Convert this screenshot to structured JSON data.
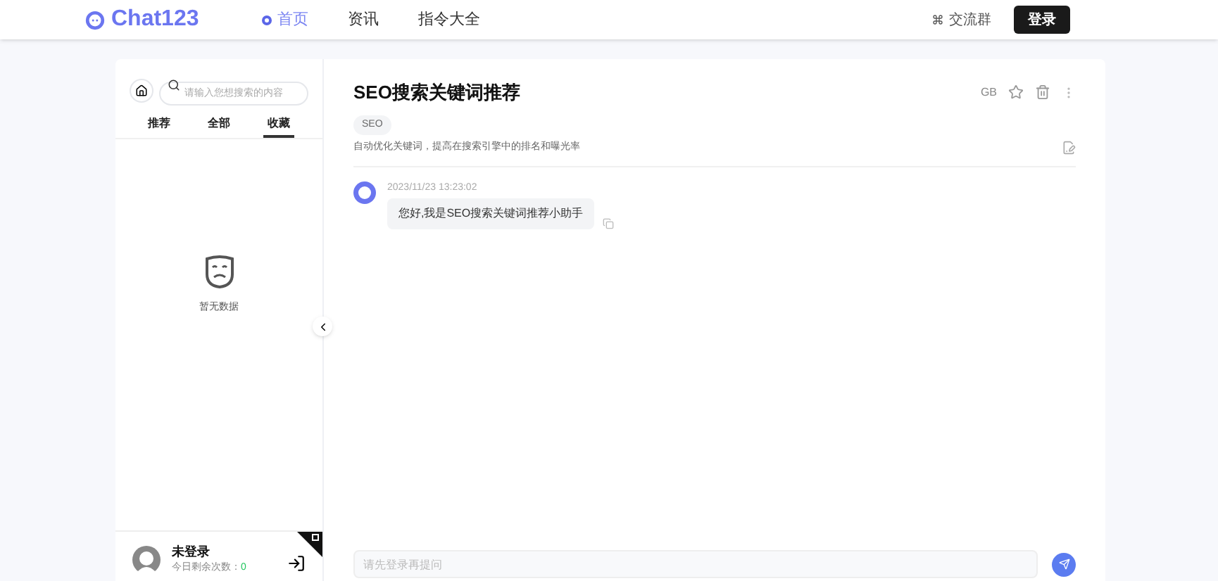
{
  "header": {
    "logo": "Chat123",
    "nav": [
      {
        "label": "首页",
        "selected": true
      },
      {
        "label": "资讯",
        "selected": false
      },
      {
        "label": "指令大全",
        "selected": false
      }
    ],
    "group_link": "交流群",
    "login_button": "登录"
  },
  "sidebar": {
    "search": {
      "placeholder": "请输入您想搜索的内容"
    },
    "tabs": [
      {
        "label": "推荐",
        "selected": false
      },
      {
        "label": "全部",
        "selected": false
      },
      {
        "label": "收藏",
        "selected": true
      }
    ],
    "empty_text": "暂无数据",
    "user": {
      "name": "未登录",
      "quota_label": "今日剩余次数：",
      "quota": "0"
    }
  },
  "chat": {
    "title": "SEO搜索关键词推荐",
    "tag": "SEO",
    "description": "自动优化关键词，提高在搜索引擎中的排名和曝光率",
    "lang": "GB",
    "messages": [
      {
        "time": "2023/11/23 13:23:02",
        "text": "您好,我是SEO搜索关键词推荐小助手"
      }
    ],
    "input": {
      "placeholder": "请先登录再提问"
    }
  }
}
